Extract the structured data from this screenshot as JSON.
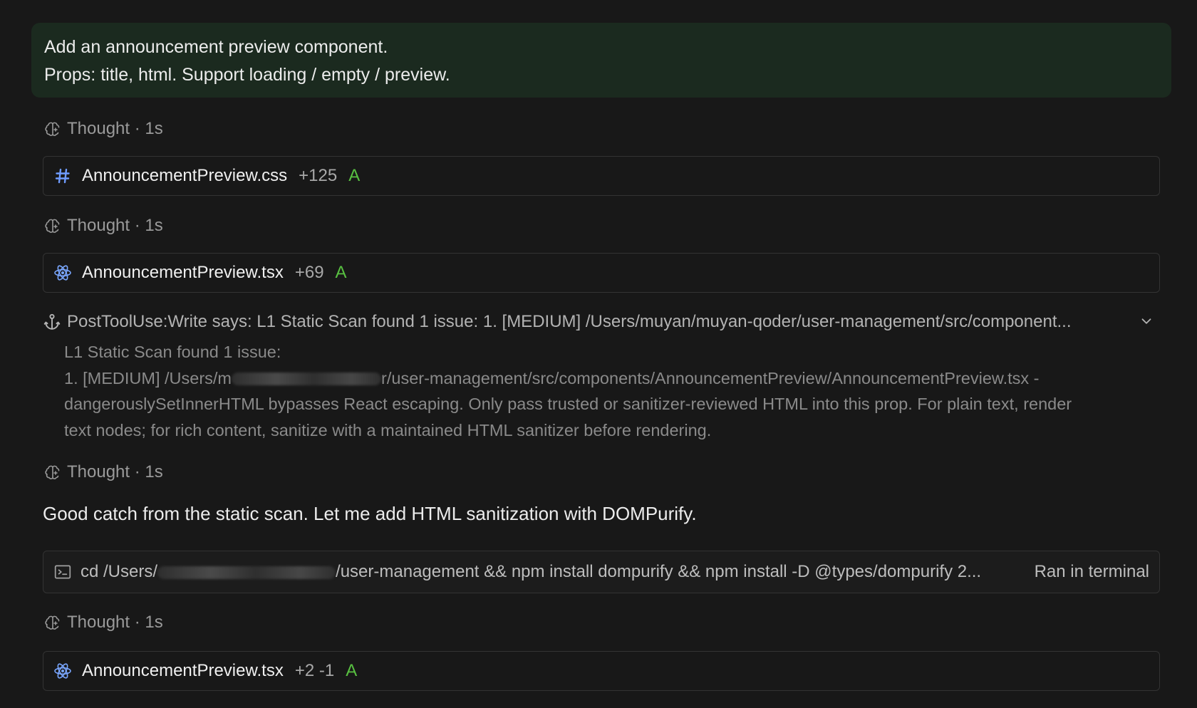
{
  "prompt": {
    "line1": "Add an announcement preview component.",
    "line2": "Props: title, html. Support loading / empty / preview."
  },
  "thought_label": "Thought · 1s",
  "files": [
    {
      "name": "AnnouncementPreview.css",
      "diff": "+125",
      "status": "A",
      "icon": "css-hash-icon"
    },
    {
      "name": "AnnouncementPreview.tsx",
      "diff": "+69",
      "status": "A",
      "icon": "react-icon"
    },
    {
      "name": "AnnouncementPreview.tsx",
      "diff": "+2 -1",
      "status": "A",
      "icon": "react-icon"
    }
  ],
  "hook": {
    "summary": "PostToolUse:Write says: L1 Static Scan found 1 issue: 1. [MEDIUM] /Users/muyan/muyan-qoder/user-management/src/component...",
    "detail_line1": "L1 Static Scan found 1 issue:",
    "detail_line2_prefix": "1. [MEDIUM] /Users/m",
    "detail_line2_suffix": "r/user-management/src/components/AnnouncementPreview/AnnouncementPreview.tsx -",
    "detail_line3": "dangerouslySetInnerHTML bypasses React escaping. Only pass trusted or sanitizer-reviewed HTML into this prop. For plain text, render",
    "detail_line4": "text nodes; for rich content, sanitize with a maintained HTML sanitizer before rendering."
  },
  "message": "Good catch from the static scan. Let me add HTML sanitization with DOMPurify.",
  "terminal": {
    "cmd_prefix": "cd /Users/",
    "cmd_suffix": "/user-management && npm install dompurify && npm install -D @types/dompurify 2...",
    "status": "Ran in terminal"
  },
  "colors": {
    "background": "#181818",
    "prompt_bg": "#1b2a1f",
    "added_status": "#58c041",
    "css_icon": "#6f9cff",
    "react_icon": "#7aa7ff"
  }
}
